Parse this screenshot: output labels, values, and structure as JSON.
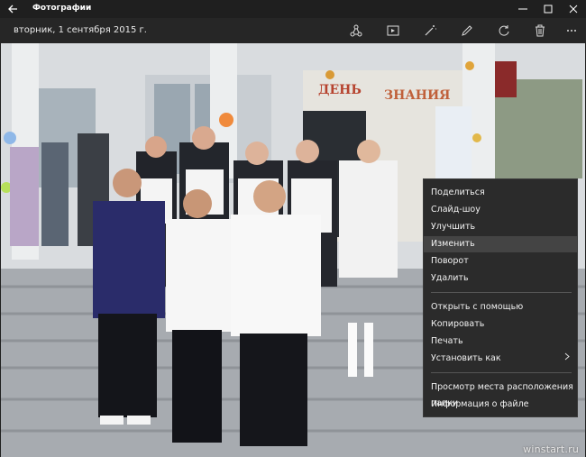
{
  "window": {
    "title": "Фотографии"
  },
  "toolbar": {
    "date": "вторник, 1 сентября 2015 г."
  },
  "photo": {
    "banner_text_1": "ДЕНЬ",
    "banner_text_2": "ЗНАНИЯ"
  },
  "context_menu": {
    "share": "Поделиться",
    "slideshow": "Слайд-шоу",
    "enhance": "Улучшить",
    "edit": "Изменить",
    "rotate": "Поворот",
    "delete": "Удалить",
    "open_with": "Открыть с помощью",
    "copy": "Копировать",
    "print": "Печать",
    "set_as": "Установить как",
    "view_folder": "Просмотр места расположения папки",
    "file_info": "Информация о файле"
  },
  "watermark": "winstart.ru",
  "colors": {
    "titlebar": "#1f1f1f",
    "toolbar": "#262626",
    "menu_bg": "#2b2b2b",
    "menu_highlight": "#444444"
  }
}
